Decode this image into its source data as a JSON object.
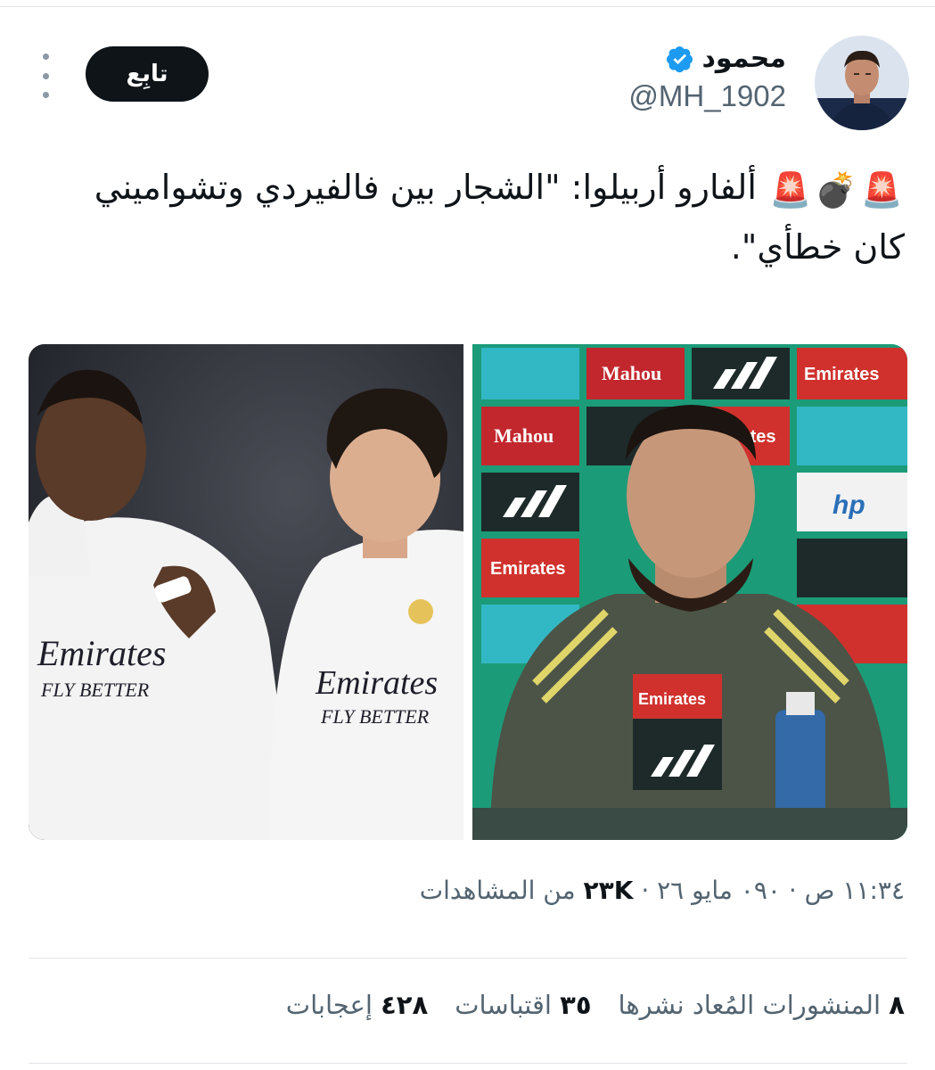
{
  "author": {
    "display_name": "محمود",
    "handle": "@MH_1902",
    "verified_icon": "verified-badge-icon",
    "avatar_icon": "avatar-image"
  },
  "follow_button": "تابِع",
  "tweet": {
    "line1": "ألفارو أربيلوا: \"الشجار بين فالفيردي وتشواميني",
    "line2": "كان خطأي\".",
    "emojis": [
      "🚨",
      "💣",
      "🚨"
    ]
  },
  "media": {
    "left_image_icon": "players-photo",
    "right_image_icon": "press-conference-photo",
    "jersey_text": "Emirates",
    "jersey_sub": "FLY BETTER",
    "sponsor_labels": [
      "Mahou",
      "Emirates",
      "hp"
    ]
  },
  "meta": {
    "time": "١١:٣٤ ص",
    "date": "٠٩٠ مايو ٢٦",
    "separator": "·",
    "views_count": "٢٣K",
    "views_label": "من المشاهدات"
  },
  "stats": {
    "reposts_count": "٨",
    "reposts_label": "المنشورات المُعاد نشرها",
    "quotes_count": "٣٥",
    "quotes_label": "اقتباسات",
    "likes_count": "٤٢٨",
    "likes_label": "إعجابات"
  },
  "colors": {
    "text_primary": "#0f1419",
    "text_secondary": "#536471",
    "verified_blue": "#1d9bf0",
    "follow_bg": "#0f1419"
  }
}
